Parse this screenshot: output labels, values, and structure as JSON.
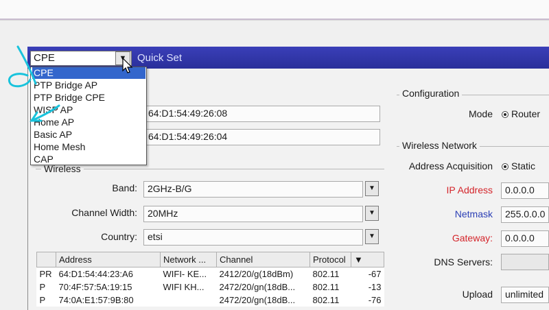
{
  "window": {
    "title": "Quick Set"
  },
  "mode_select": {
    "value": "CPE",
    "options": [
      "CPE",
      "PTP Bridge AP",
      "PTP Bridge CPE",
      "WISP AP",
      "Home AP",
      "Basic AP",
      "Home Mesh",
      "CAP"
    ],
    "selected_index": 0
  },
  "mac_fields": [
    "64:D1:54:49:26:08",
    "64:D1:54:49:26:04"
  ],
  "wireless": {
    "group_label": "Wireless",
    "band_label": "Band:",
    "band_value": "2GHz-B/G",
    "channel_width_label": "Channel Width:",
    "channel_width_value": "20MHz",
    "country_label": "Country:",
    "country_value": "etsi"
  },
  "scan_table": {
    "columns": [
      "",
      "Address",
      "Network ...",
      "Channel",
      "Protocol",
      ""
    ],
    "rows": [
      [
        "PR",
        "64:D1:54:44:23:A6",
        "WIFI- KE...",
        "2412/20/g(18dBm)",
        "802.11",
        "-67"
      ],
      [
        "P",
        "70:4F:57:5A:19:15",
        "WIFI KH...",
        "2472/20/gn(18dB...",
        "802.11",
        "-13"
      ],
      [
        "P",
        "74:0A:E1:57:9B:80",
        "",
        "2472/20/gn(18dB...",
        "802.11",
        "-76"
      ]
    ]
  },
  "configuration": {
    "group_label": "Configuration",
    "mode_label": "Mode",
    "mode_value": "Router"
  },
  "wireless_network": {
    "group_label": "Wireless Network",
    "acq_label": "Address Acquisition",
    "acq_value": "Static",
    "ip_label": "IP Address",
    "ip_value": "0.0.0.0",
    "netmask_label": "Netmask",
    "netmask_value": "255.0.0.0",
    "gateway_label": "Gateway:",
    "gateway_value": "0.0.0.0",
    "dns_label": "DNS Servers:",
    "dns_value": "",
    "upload_label": "Upload",
    "upload_value": "unlimited"
  },
  "colors": {
    "title_bar": "#2f34a8",
    "selection": "#3366cc",
    "required_label": "#d4242a",
    "netmask_label": "#2b3fb5",
    "annotation": "#19c3dc"
  },
  "icons": {
    "dropdown_arrow": "chevron-down-icon",
    "cursor": "mouse-pointer-icon"
  }
}
